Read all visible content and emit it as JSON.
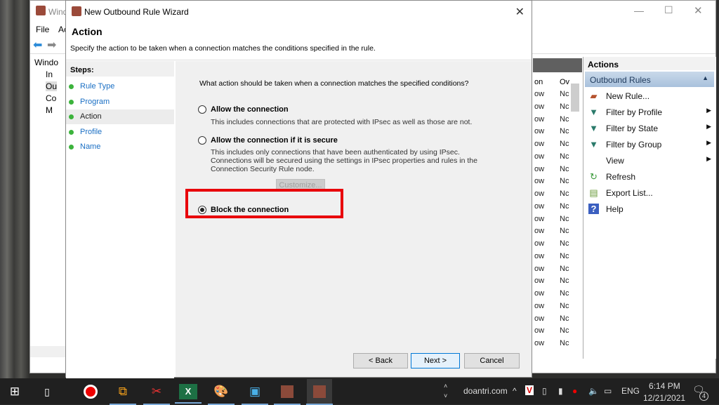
{
  "mmc": {
    "title": "Windows Defender Firewall with Advanced Security",
    "title_visible": "Wind",
    "menu": [
      "File",
      "Ac"
    ],
    "tree": [
      "Windo",
      "In",
      "Ou",
      "Co",
      "M"
    ],
    "columns": [
      "on",
      "Ov"
    ],
    "rows": [
      [
        "ow",
        "Nc"
      ],
      [
        "ow",
        "Nc"
      ],
      [
        "ow",
        "Nc"
      ],
      [
        "ow",
        "Nc"
      ],
      [
        "ow",
        "Nc"
      ],
      [
        "ow",
        "Nc"
      ],
      [
        "ow",
        "Nc"
      ],
      [
        "ow",
        "Nc"
      ],
      [
        "ow",
        "Nc"
      ],
      [
        "ow",
        "Nc"
      ],
      [
        "ow",
        "Nc"
      ],
      [
        "ow",
        "Nc"
      ],
      [
        "ow",
        "Nc"
      ],
      [
        "ow",
        "Nc"
      ],
      [
        "ow",
        "Nc"
      ],
      [
        "ow",
        "Nc"
      ],
      [
        "ow",
        "Nc"
      ],
      [
        "ow",
        "Nc"
      ],
      [
        "ow",
        "Nc"
      ],
      [
        "ow",
        "Nc"
      ],
      [
        "ow",
        "Nc"
      ]
    ]
  },
  "actions": {
    "header": "Actions",
    "section": "Outbound Rules",
    "items": [
      {
        "label": "New Rule...",
        "icon": "new-rule-icon",
        "arrow": false
      },
      {
        "label": "Filter by Profile",
        "icon": "filter-icon",
        "arrow": true
      },
      {
        "label": "Filter by State",
        "icon": "filter-icon",
        "arrow": true
      },
      {
        "label": "Filter by Group",
        "icon": "filter-icon",
        "arrow": true
      },
      {
        "label": "View",
        "icon": "",
        "arrow": true
      },
      {
        "label": "Refresh",
        "icon": "refresh-icon",
        "arrow": false
      },
      {
        "label": "Export List...",
        "icon": "export-icon",
        "arrow": false
      },
      {
        "label": "Help",
        "icon": "help-icon",
        "arrow": false
      }
    ]
  },
  "wizard": {
    "title": "New Outbound Rule Wizard",
    "heading": "Action",
    "subtitle": "Specify the action to be taken when a connection matches the conditions specified in the rule.",
    "steps_label": "Steps:",
    "steps": [
      "Rule Type",
      "Program",
      "Action",
      "Profile",
      "Name"
    ],
    "current_step": "Action",
    "question": "What action should be taken when a connection matches the specified conditions?",
    "options": [
      {
        "label": "Allow the connection",
        "desc": "This includes connections that are protected with IPsec as well as those are not.",
        "selected": false
      },
      {
        "label": "Allow the connection if it is secure",
        "desc": "This includes only connections that have been authenticated by using IPsec.  Connections will be secured using the settings in IPsec properties and rules in the Connection Security Rule node.",
        "selected": false
      },
      {
        "label": "Block the connection",
        "desc": "",
        "selected": true
      }
    ],
    "customize": "Customize...",
    "back": "< Back",
    "next": "Next >",
    "cancel": "Cancel"
  },
  "taskbar": {
    "site": "doantri.com",
    "lang": "ENG",
    "time": "6:14 PM",
    "date": "12/21/2021",
    "notifications": "4"
  },
  "colors": {
    "highlight": "#e8000b",
    "step_link": "#1a6fc4",
    "step_dot": "#3cb33c"
  }
}
